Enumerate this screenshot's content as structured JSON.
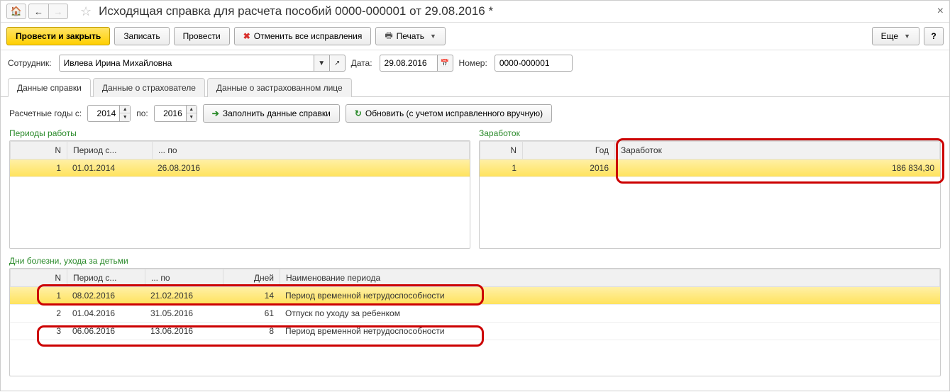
{
  "titlebar": {
    "title": "Исходящая справка для расчета пособий 0000-000001 от 29.08.2016 *"
  },
  "toolbar": {
    "post_close": "Провести и закрыть",
    "save": "Записать",
    "post": "Провести",
    "cancel_changes": "Отменить все исправления",
    "print": "Печать",
    "more": "Еще"
  },
  "form": {
    "employee_label": "Сотрудник:",
    "employee_value": "Ивлева Ирина Михайловна",
    "date_label": "Дата:",
    "date_value": "29.08.2016",
    "number_label": "Номер:",
    "number_value": "0000-000001"
  },
  "tabs": {
    "t1": "Данные справки",
    "t2": "Данные о страхователе",
    "t3": "Данные о застрахованном лице"
  },
  "subrow": {
    "years_from_label": "Расчетные годы с:",
    "year_from": "2014",
    "to_label": "по:",
    "year_to": "2016",
    "fill": "Заполнить данные справки",
    "refresh": "Обновить (с учетом исправленного вручную)"
  },
  "periods": {
    "title": "Периоды работы",
    "cols": {
      "n": "N",
      "from": "Период с...",
      "to": "... по"
    },
    "rows": [
      {
        "n": "1",
        "from": "01.01.2014",
        "to": "26.08.2016"
      }
    ]
  },
  "earnings": {
    "title": "Заработок",
    "cols": {
      "n": "N",
      "year": "Год",
      "amount": "Заработок"
    },
    "rows": [
      {
        "n": "1",
        "year": "2016",
        "amount": "186 834,30"
      }
    ]
  },
  "sickdays": {
    "title": "Дни болезни, ухода за детьми",
    "cols": {
      "n": "N",
      "from": "Период с...",
      "to": "... по",
      "days": "Дней",
      "name": "Наименование периода"
    },
    "rows": [
      {
        "n": "1",
        "from": "08.02.2016",
        "to": "21.02.2016",
        "days": "14",
        "name": "Период временной нетрудоспособности"
      },
      {
        "n": "2",
        "from": "01.04.2016",
        "to": "31.05.2016",
        "days": "61",
        "name": "Отпуск по уходу за ребенком"
      },
      {
        "n": "3",
        "from": "06.06.2016",
        "to": "13.06.2016",
        "days": "8",
        "name": "Период временной нетрудоспособности"
      }
    ]
  }
}
